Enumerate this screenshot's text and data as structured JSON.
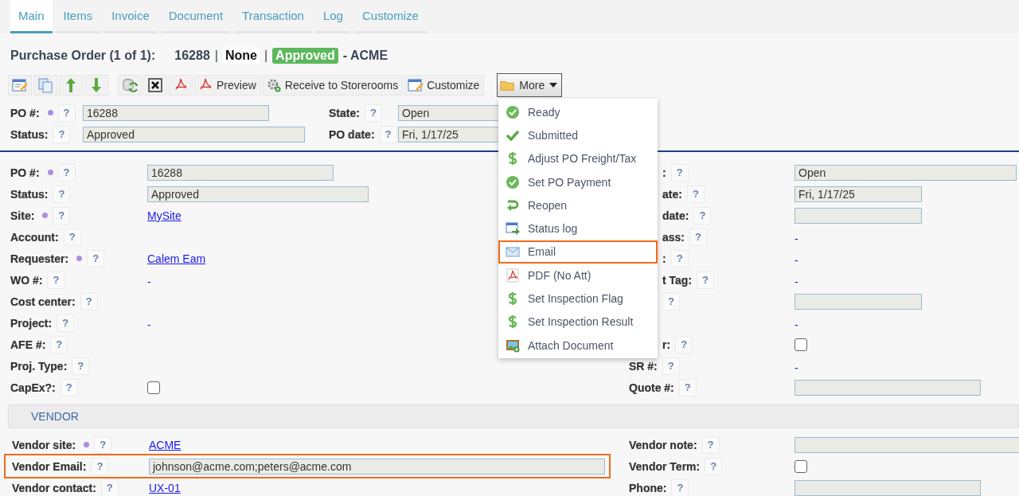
{
  "tabs": [
    {
      "label": "Main",
      "selected": true
    },
    {
      "label": "Items",
      "selected": false
    },
    {
      "label": "Invoice",
      "selected": false
    },
    {
      "label": "Document",
      "selected": false
    },
    {
      "label": "Transaction",
      "selected": false
    },
    {
      "label": "Log",
      "selected": false
    },
    {
      "label": "Customize",
      "selected": false
    }
  ],
  "header": {
    "title": "Purchase Order (1 of 1):",
    "number": "16288",
    "separator_1": "|",
    "state": "None",
    "separator_2": "|",
    "status": "Approved",
    "vendor": "- ACME"
  },
  "toolbar": {
    "preview": "Preview",
    "receive": "Receive to Storerooms",
    "customize": "Customize",
    "more": {
      "label": "More",
      "open": true
    }
  },
  "menu": [
    {
      "kind": "check-circle",
      "label": "Ready",
      "selected": false
    },
    {
      "kind": "check",
      "label": "Submitted",
      "selected": false
    },
    {
      "kind": "dollar",
      "label": "Adjust PO Freight/Tax",
      "selected": false
    },
    {
      "kind": "check-circle",
      "label": "Set PO Payment",
      "selected": false
    },
    {
      "kind": "return",
      "label": "Reopen",
      "selected": false
    },
    {
      "kind": "log",
      "label": "Status log",
      "selected": false
    },
    {
      "kind": "mail",
      "label": "Email",
      "selected": true
    },
    {
      "kind": "pdf",
      "label": "PDF (No Att)",
      "selected": false
    },
    {
      "kind": "dollar",
      "label": "Set Inspection Flag",
      "selected": false
    },
    {
      "kind": "dollar",
      "label": "Set Inspection Result",
      "selected": false
    },
    {
      "kind": "attach",
      "label": "Attach Document",
      "selected": false
    }
  ],
  "summary": [
    {
      "left": {
        "label": "PO #:",
        "required": true,
        "help": "?",
        "value": {
          "kind": "field",
          "text": "16288"
        }
      },
      "right": {
        "label": "State:",
        "help": "?",
        "value": {
          "kind": "field",
          "text": "Open"
        }
      }
    },
    {
      "left": {
        "label": "Status:",
        "help": "?",
        "value": {
          "kind": "field",
          "text": "Approved"
        }
      },
      "right": {
        "label": "PO date:",
        "help": "?",
        "value": {
          "kind": "field",
          "text": "Fri, 1/17/25"
        }
      }
    }
  ],
  "detail": [
    {
      "left": {
        "label": "PO #:",
        "required": true,
        "help": "?",
        "value": {
          "kind": "field",
          "text": "16288"
        }
      },
      "right": {
        "label": ":",
        "covered": true,
        "help": "?",
        "value": {
          "kind": "field",
          "text": "Open"
        }
      }
    },
    {
      "left": {
        "label": "Status:",
        "help": "?",
        "value": {
          "kind": "field",
          "text": "Approved"
        }
      },
      "right": {
        "label": "ate:",
        "covered": true,
        "help": "?",
        "value": {
          "kind": "field",
          "text": "Fri, 1/17/25"
        }
      }
    },
    {
      "left": {
        "label": "Site:",
        "required": true,
        "help": "?",
        "value": {
          "kind": "link",
          "text": "MySite"
        }
      },
      "right": {
        "label": "date:",
        "covered": true,
        "help": "?",
        "value": {
          "kind": "field"
        }
      }
    },
    {
      "left": {
        "label": "Account:",
        "help": "?"
      },
      "right": {
        "label": "ass:",
        "covered": true,
        "help": "?",
        "value": {
          "kind": "link",
          "text": "-"
        }
      }
    },
    {
      "left": {
        "label": "Requester:",
        "required": true,
        "help": "?",
        "value": {
          "kind": "link",
          "text": "Calem Eam"
        }
      },
      "right": {
        "label": ":",
        "covered": true,
        "help": "?",
        "value": {
          "kind": "link",
          "text": "-"
        }
      }
    },
    {
      "left": {
        "label": "WO #:",
        "help": "?",
        "value": {
          "kind": "link",
          "text": "-"
        }
      },
      "right": {
        "label": "t Tag:",
        "covered": true,
        "help": "?",
        "value": {
          "kind": "link",
          "text": "-"
        }
      }
    },
    {
      "left": {
        "label": "Cost center:",
        "help": "?"
      },
      "right": {
        "covered": true,
        "help": "?",
        "value": {
          "kind": "field"
        }
      }
    },
    {
      "left": {
        "label": "Project:",
        "help": "?",
        "value": {
          "kind": "link",
          "text": "-"
        }
      },
      "right": {
        "value": {
          "kind": "link",
          "text": "-"
        }
      }
    },
    {
      "left": {
        "label": "AFE #:",
        "help": "?"
      },
      "right": {
        "label": "r:",
        "covered": true,
        "help": "?",
        "value": {
          "kind": "checkbox",
          "checked": false
        }
      }
    },
    {
      "left": {
        "label": "Proj. Type:",
        "help": "?"
      },
      "right": {
        "label": "SR #:",
        "help": "?",
        "value": {
          "kind": "link",
          "text": "-"
        }
      }
    },
    {
      "left": {
        "label": "CapEx?:",
        "help": "?",
        "value": {
          "kind": "checkbox",
          "checked": false
        }
      },
      "right": {
        "label": "Quote #:",
        "help": "?",
        "value": {
          "kind": "field"
        }
      }
    }
  ],
  "vendor_section": {
    "title": "VENDOR",
    "rows": [
      {
        "left": {
          "label": "Vendor site:",
          "required": true,
          "help": "?",
          "value": {
            "kind": "link",
            "text": "ACME"
          }
        },
        "right": {
          "label": "Vendor note:",
          "help": "?",
          "value": {
            "kind": "field"
          }
        }
      },
      {
        "highlighted": true,
        "left": {
          "label": "Vendor Email:",
          "help": "?",
          "value": {
            "kind": "field",
            "text": "johnson@acme.com;peters@acme.com"
          }
        },
        "right": {
          "label": "Vendor Term:",
          "help": "?",
          "value": {
            "kind": "checkbox",
            "checked": false
          }
        }
      },
      {
        "left": {
          "label": "Vendor contact:",
          "help": "?",
          "value": {
            "kind": "link",
            "text": "UX-01"
          }
        },
        "right": {
          "label": "Phone:",
          "help": "?",
          "value": {
            "kind": "field"
          }
        }
      }
    ]
  }
}
